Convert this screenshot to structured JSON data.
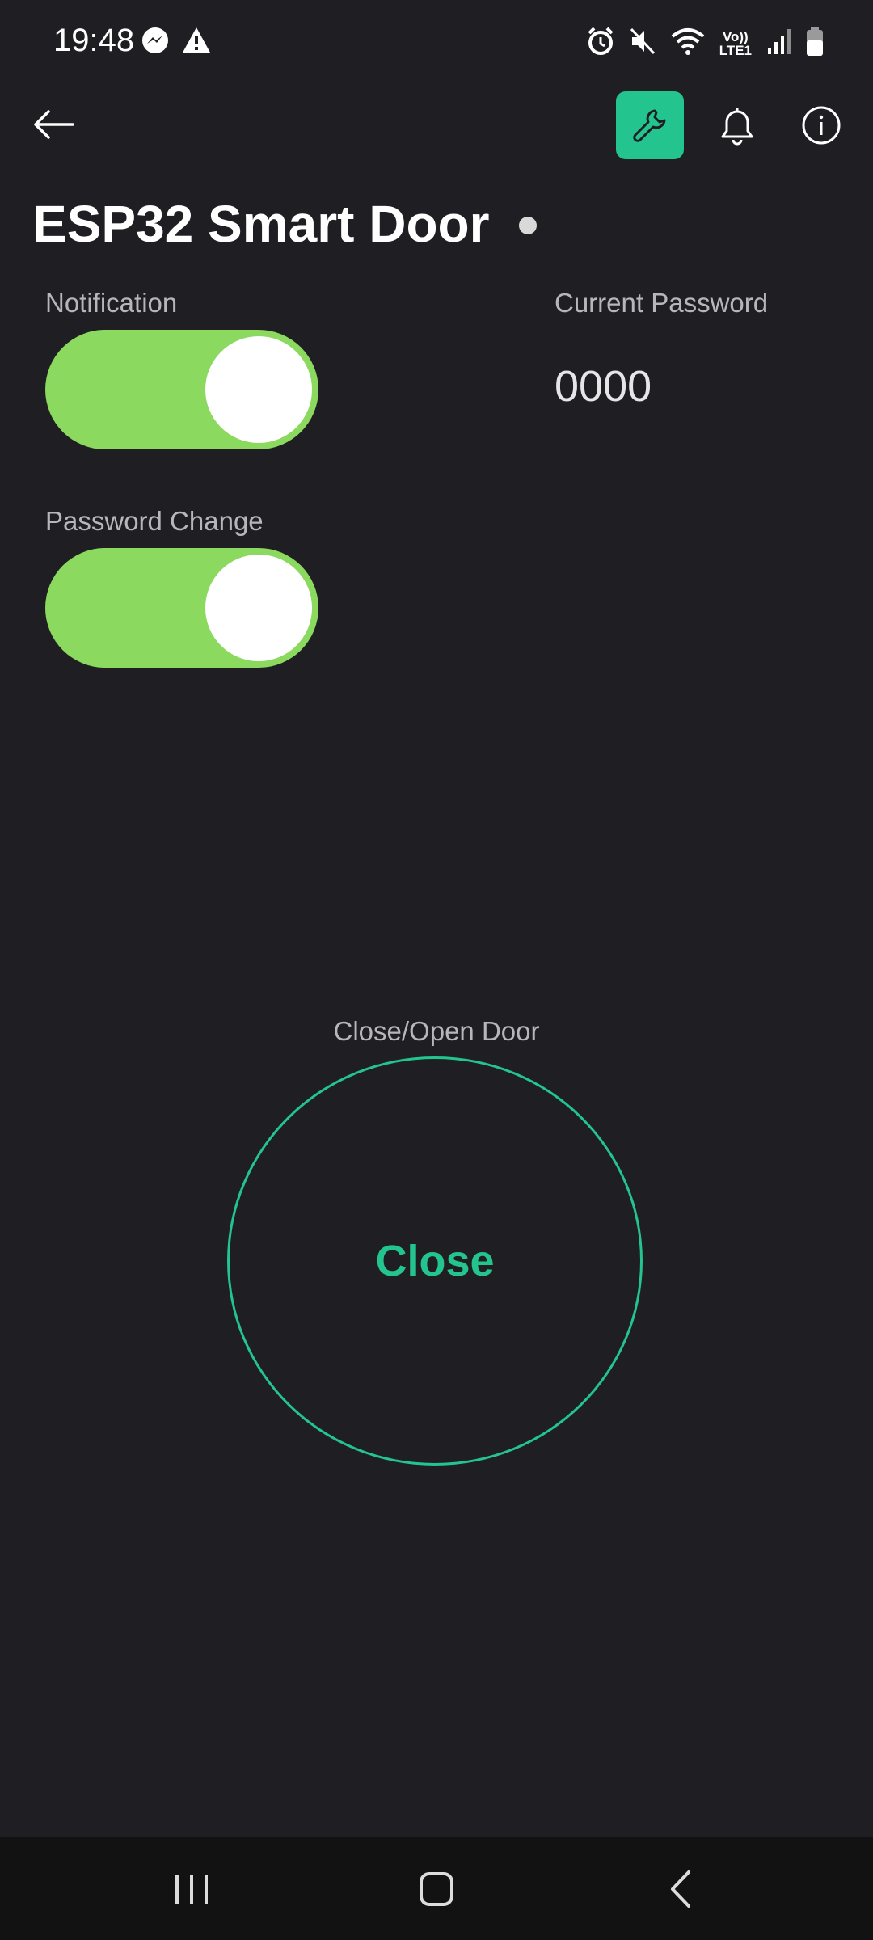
{
  "status_bar": {
    "time": "19:48",
    "left_icons": [
      "messenger-icon",
      "warning-icon"
    ],
    "right_icons": [
      "alarm-icon",
      "mute-icon",
      "wifi-icon",
      "lte-icon",
      "signal-icon",
      "battery-icon"
    ],
    "network_top": "Vo))",
    "network_bottom": "LTE1"
  },
  "app_bar": {
    "icons": [
      "back-arrow-icon",
      "wrench-icon",
      "bell-icon",
      "info-icon"
    ],
    "accent_color": "#23c48e"
  },
  "device": {
    "title": "ESP32 Smart Door"
  },
  "widgets": {
    "notification": {
      "label": "Notification",
      "on": true
    },
    "current_password": {
      "label": "Current Password",
      "value": "0000"
    },
    "password_change": {
      "label": "Password Change",
      "on": true
    },
    "door": {
      "label": "Close/Open Door",
      "button_label": "Close"
    }
  },
  "colors": {
    "background": "#1f1f23",
    "toggle_on": "#8bd95e",
    "accent": "#23c48e"
  },
  "nav_bar": {
    "icons": [
      "recent-apps-icon",
      "home-icon",
      "back-icon"
    ]
  }
}
